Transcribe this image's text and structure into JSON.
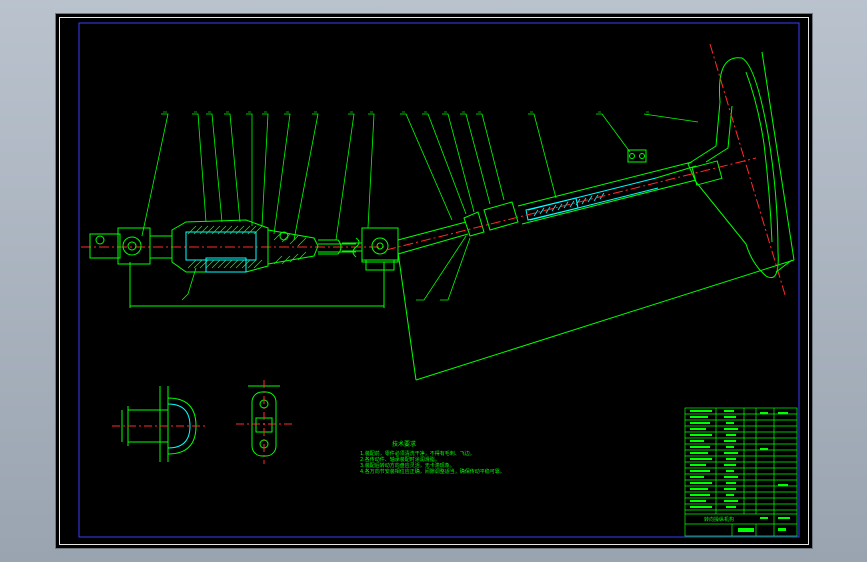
{
  "app": {
    "title": "",
    "viewport_background": "#aab3be"
  },
  "colors": {
    "paper": "#000000",
    "outline": "#00ff00",
    "border": "#3b3bff",
    "hidden_section": "#00ffff",
    "centerline": "#ff2a2a",
    "frame": "#e6e6e6"
  },
  "drawing": {
    "tech_requirements_heading": "技术要求",
    "tech_requirements_lines": [
      "1.装配前，零件必须清洗干净，不得有毛刺、飞边。",
      "2.各传动件、轴承装配时涂润滑脂。",
      "3.装配后转动方向盘应灵活，无卡滞现象。",
      "4.各万向节安装相位应正确，间隙调整适当，确保传动平稳可靠。"
    ],
    "title_block_name": "转向操纵机构"
  }
}
